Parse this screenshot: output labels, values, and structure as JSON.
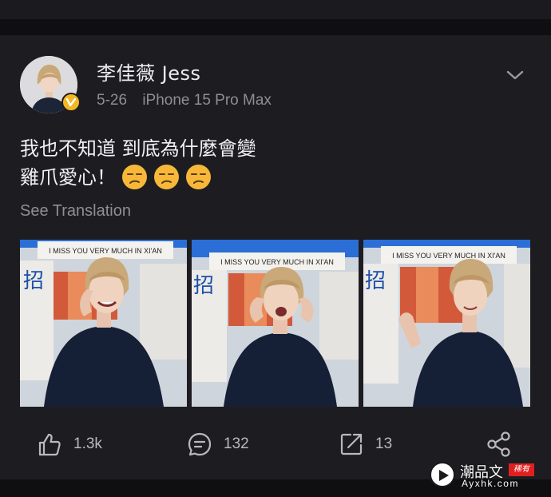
{
  "post": {
    "username": "李佳薇 Jess",
    "date": "5-26",
    "device": "iPhone 15 Pro Max",
    "text_line1": "我也不知道 到底為什麼會變",
    "text_line2": "雞爪愛心！",
    "see_translation": "See Translation",
    "photo_banner_text": "I MISS YOU VERY MUCH IN XI'AN",
    "photo_sign_char": "招"
  },
  "actions": {
    "likes": "1.3k",
    "comments": "132",
    "reposts": "13"
  },
  "watermark": {
    "title": "潮品文",
    "seal": "稀有",
    "domain": "Ayxhk.com"
  },
  "colors": {
    "background": "#0f0f12",
    "card": "#1d1d21",
    "verified_badge": "#f2b824",
    "muted_text": "#8e8e93"
  },
  "icons": [
    "chevron-down-icon",
    "verified-badge-icon",
    "like-icon",
    "comment-icon",
    "repost-icon",
    "share-icon",
    "play-icon"
  ]
}
